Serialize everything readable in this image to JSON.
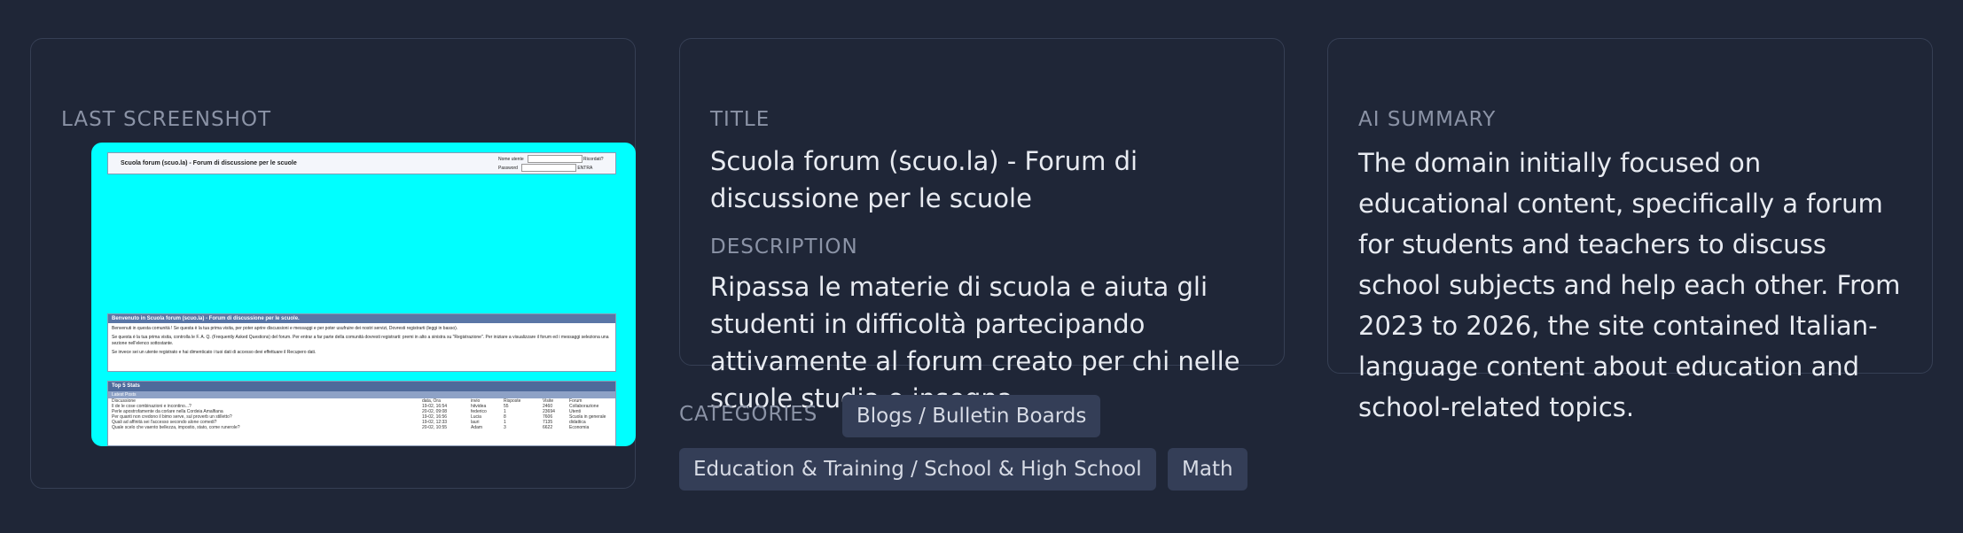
{
  "screenshot_card": {
    "label": "LAST SCREENSHOT",
    "thumbnail": {
      "background": "#00ffff",
      "header_title": "Scuola forum (scuo.la) - Forum di discussione per le scuole",
      "login_username_label": "Nome utente",
      "login_password_label": "Password",
      "login_remember": "Ricordati?",
      "login_button": "ENTRA",
      "welcome_title": "Benvenuto in Scuola forum (scuo.la) - Forum di discussione per le scuole.",
      "welcome_text_1": "Benvenuti in questa comunità ! Se questa è la tua prima visita, per poter aprire discussioni e messaggi e per poter usufruire dei nostri servizi, Dovresti registrarti (leggi in basso).",
      "welcome_text_2": "Se questa è la tua prima visita, controlla le F. A. Q. (Frequently Asked Questions) del forum. Per entrar a far parte della comunità dovresti registrarti: premi in alto a sinistra su \"Registrazione\". Per iniziare a visualizzare il forum ed i messaggi seleziona una sezione nell'elenco sottostante.",
      "welcome_text_3": "Se invece sei un utente registrato e hai dimenticato i tuoi dati di accesso devi effettuare il Recupero dati.",
      "stats_title": "Top 5 Stats",
      "stats_sub": "Latest Posts",
      "stats_headers": [
        "Discussione",
        "data, Ora",
        "invio",
        "Risposte",
        "Visite",
        "Forum"
      ],
      "stats_rows": [
        [
          "Il de le cose combinazioni e incontino...?",
          "19-02, 16:54",
          "hitvidea",
          "55",
          "2460",
          "Collaborazione"
        ],
        [
          "Perle apostrofamente da corlare nella Cordeia Amalfiana",
          "20-02, 09:08",
          "federico",
          "1",
          "23694",
          "Utenti"
        ],
        [
          "Per quanti non credono il bimo serve, sul proverb un stilletto?",
          "19-02, 16:56",
          "Lucia",
          "8",
          "7606",
          "Scuola in generale"
        ],
        [
          "Quali ad affinità sei l'accesso secondo alone comedi?",
          "19-02, 12:33",
          "lauri",
          "1",
          "7135",
          "didattica"
        ],
        [
          "Quale scelo che vaento bellezza, impostio, stato, come runerole?",
          "20-02, 10:55",
          "Adam",
          "3",
          "6622",
          "Economia"
        ]
      ]
    }
  },
  "title_card": {
    "title_label": "TITLE",
    "title_value": "Scuola forum (scuo.la) - Forum di discussione per le scuole",
    "description_label": "DESCRIPTION",
    "description_value": "Ripassa le materie di scuola e aiuta gli studenti in difficoltà partecipando attivamente al forum creato per chi nelle scuole studia o insegna"
  },
  "ai_card": {
    "label": "AI SUMMARY",
    "summary": "The domain initially focused on educational content, specifically a forum for students and teachers to discuss school subjects and help each other. From 2023 to 2026, the site contained Italian-language content about education and school-related topics."
  },
  "categories": {
    "label": "CATEGORIES",
    "items": [
      "Blogs / Bulletin Boards",
      "Education & Training / School & High School",
      "Math"
    ]
  },
  "colors": {
    "background": "#1f2637",
    "card_border": "#363f54",
    "chip_background": "#343e57",
    "label_text": "#8b93a6"
  }
}
